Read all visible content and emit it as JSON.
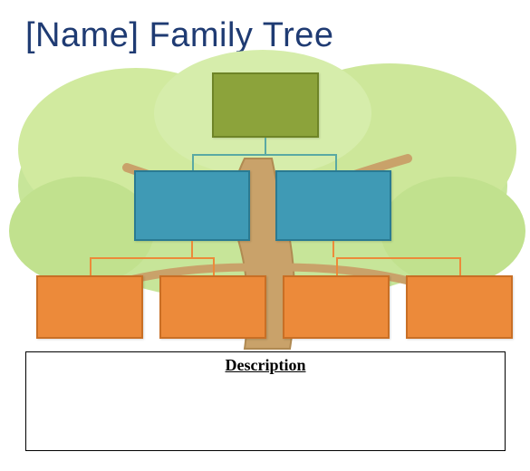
{
  "title": "[Name] Family Tree",
  "description_heading": "Description",
  "chart_data": {
    "type": "tree",
    "title": "[Name] Family Tree",
    "levels": [
      {
        "level": 1,
        "color": "#8ca33b",
        "nodes": [
          {
            "id": "root",
            "label": ""
          }
        ]
      },
      {
        "level": 2,
        "color": "#3f9ab5",
        "nodes": [
          {
            "id": "p1",
            "label": ""
          },
          {
            "id": "p2",
            "label": ""
          }
        ]
      },
      {
        "level": 3,
        "color": "#ec8a3a",
        "nodes": [
          {
            "id": "c1",
            "label": ""
          },
          {
            "id": "c2",
            "label": ""
          },
          {
            "id": "c3",
            "label": ""
          },
          {
            "id": "c4",
            "label": ""
          }
        ]
      }
    ],
    "edges": [
      [
        "root",
        "p1"
      ],
      [
        "root",
        "p2"
      ],
      [
        "p1",
        "c1"
      ],
      [
        "p1",
        "c2"
      ],
      [
        "p2",
        "c3"
      ],
      [
        "p2",
        "c4"
      ]
    ]
  }
}
